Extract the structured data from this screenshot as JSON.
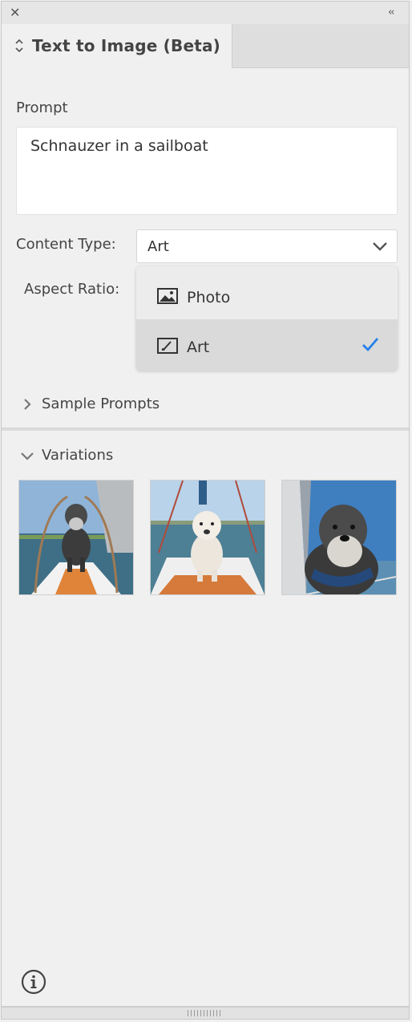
{
  "panel": {
    "tab_label": "Text to Image (Beta)",
    "prompt_label": "Prompt",
    "prompt_value": "Schnauzer in a sailboat",
    "content_type_label": "Content Type:",
    "content_type_value": "Art",
    "aspect_ratio_label": "Aspect Ratio:",
    "menu_items": [
      {
        "label": "Photo",
        "icon": "image-icon",
        "selected": false
      },
      {
        "label": "Art",
        "icon": "art-brush-icon",
        "selected": true
      }
    ],
    "sample_prompts_label": "Sample Prompts",
    "variations_label": "Variations",
    "variations": [
      {
        "subject": "schnauzer-sitting-on-sailboat-bow"
      },
      {
        "subject": "white-terrier-on-sailboat-deck"
      },
      {
        "subject": "schnauzer-closeup-with-bandana"
      }
    ]
  },
  "colors": {
    "accent_check": "#2680eb",
    "panel_bg": "#f0f0f0",
    "menu_selected_bg": "#dadada"
  }
}
